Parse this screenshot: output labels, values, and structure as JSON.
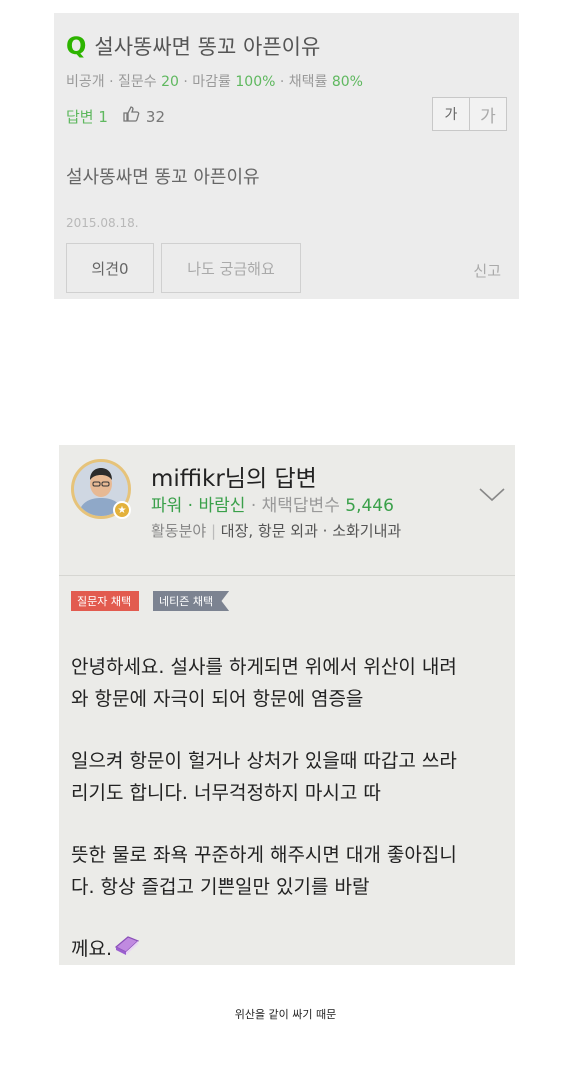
{
  "question": {
    "title": "설사똥싸면 똥꼬 아픈이유",
    "meta_prefix": "비공개 · 질문수 ",
    "question_count": "20",
    "meta_deadline_label": " · 마감률 ",
    "deadline_rate": "100%",
    "meta_adopt_label": " · 채택률 ",
    "adopt_rate": "80%",
    "answer_label": "답변 1",
    "likes": "32",
    "font_small": "가",
    "font_large": "가",
    "body": "설사똥싸면 똥꼬 아픈이유",
    "date": "2015.08.18.",
    "opinion_button": "의견0",
    "curious_button": "나도 궁금해요",
    "report": "신고"
  },
  "answer": {
    "name": "miffikr님의 답변",
    "rank": "파워 · 바람신",
    "adopt_label": " · 채택답변수 ",
    "adopt_count": "5,446",
    "field_label": "활동분야 ",
    "field_sep": "| ",
    "fields": "대장, 항문 외과 · 소화기내과",
    "tag_asker": "질문자 채택",
    "tag_netizen": "네티즌 채택",
    "lines": [
      [
        "안녕하세요. 설사를 하게되면 위에서 위산이 내려",
        "와 항문에 자극이 되어 항문에 염증을"
      ],
      [
        "일으켜 항문이 헐거나  상처가 있을때 따갑고 쓰라",
        "리기도 합니다. 너무걱정하지 마시고 따"
      ],
      [
        "뜻한 물로 좌욕 꾸준하게 해주시면 대개 좋아집니",
        "다. 항상 즐겁고 기쁜일만 있기를 바랄"
      ],
      [
        "께요."
      ]
    ]
  },
  "caption": "위산을 같이 싸기 때문",
  "colors": {
    "green": "#2db400",
    "tag_red": "#e25b4f",
    "tag_gray": "#7c8391"
  },
  "icons": {
    "question": "q-icon",
    "thumb": "thumbs-up-icon",
    "chevron": "chevron-down-icon",
    "book": "book-icon"
  }
}
